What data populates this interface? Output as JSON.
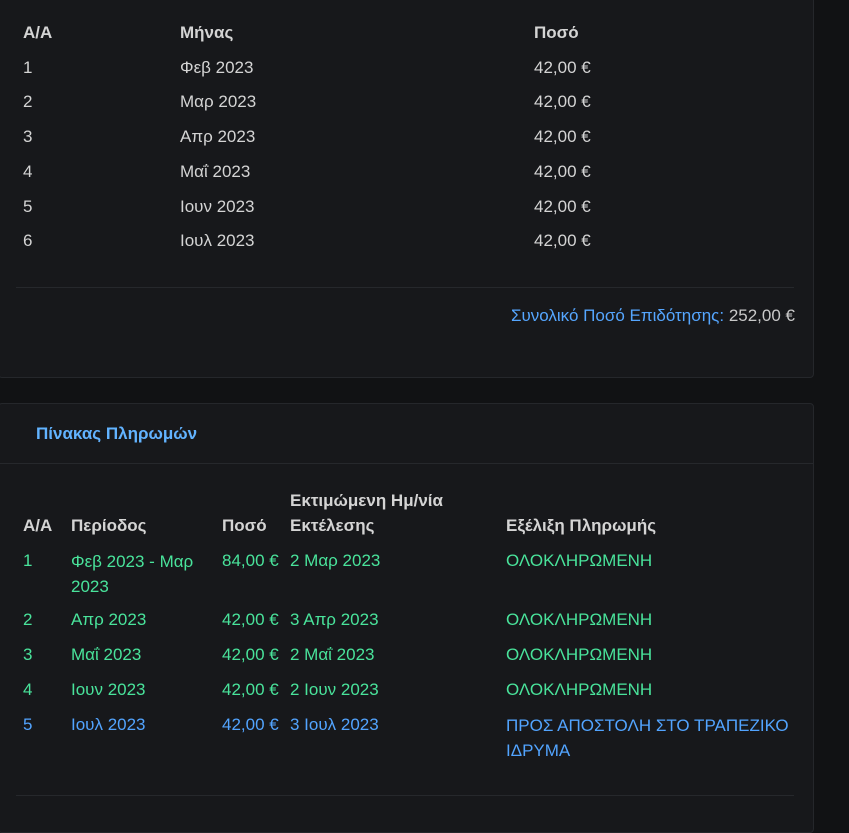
{
  "subsidy_table": {
    "headers": {
      "aa": "Α/Α",
      "month": "Μήνας",
      "amount": "Ποσό"
    },
    "rows": [
      {
        "aa": "1",
        "month": "Φεβ 2023",
        "amount": "42,00 €"
      },
      {
        "aa": "2",
        "month": "Μαρ 2023",
        "amount": "42,00 €"
      },
      {
        "aa": "3",
        "month": "Απρ 2023",
        "amount": "42,00 €"
      },
      {
        "aa": "4",
        "month": "Μαΐ 2023",
        "amount": "42,00 €"
      },
      {
        "aa": "5",
        "month": "Ιουν 2023",
        "amount": "42,00 €"
      },
      {
        "aa": "6",
        "month": "Ιουλ 2023",
        "amount": "42,00 €"
      }
    ],
    "total_label": "Συνολικό Ποσό Επιδότησης:",
    "total_value": "252,00 €"
  },
  "payments": {
    "title": "Πίνακας Πληρωμών",
    "headers": {
      "aa": "Α/Α",
      "period": "Περίοδος",
      "amount": "Ποσό",
      "date": "Εκτιμώμενη Ημ/νία Εκτέλεσης",
      "status": "Εξέλιξη Πληρωμής"
    },
    "colors": {
      "completed": "#49e39b",
      "pending": "#52a4ff"
    },
    "rows": [
      {
        "aa": "1",
        "period": "Φεβ 2023 - Μαρ 2023",
        "amount": "84,00 €",
        "date": "2 Μαρ 2023",
        "status": "ΟΛΟΚΛΗΡΩΜΕΝΗ",
        "state": "completed"
      },
      {
        "aa": "2",
        "period": "Απρ 2023",
        "amount": "42,00 €",
        "date": "3 Απρ 2023",
        "status": "ΟΛΟΚΛΗΡΩΜΕΝΗ",
        "state": "completed"
      },
      {
        "aa": "3",
        "period": "Μαΐ 2023",
        "amount": "42,00 €",
        "date": "2 Μαΐ 2023",
        "status": "ΟΛΟΚΛΗΡΩΜΕΝΗ",
        "state": "completed"
      },
      {
        "aa": "4",
        "period": "Ιουν 2023",
        "amount": "42,00 €",
        "date": "2 Ιουν 2023",
        "status": "ΟΛΟΚΛΗΡΩΜΕΝΗ",
        "state": "completed"
      },
      {
        "aa": "5",
        "period": "Ιουλ 2023",
        "amount": "42,00 €",
        "date": "3 Ιουλ 2023",
        "status": "ΠΡΟΣ ΑΠΟΣΤΟΛΗ ΣΤΟ ΤΡΑΠΕΖΙΚΟ ΙΔΡΥΜΑ",
        "state": "pending"
      }
    ]
  }
}
